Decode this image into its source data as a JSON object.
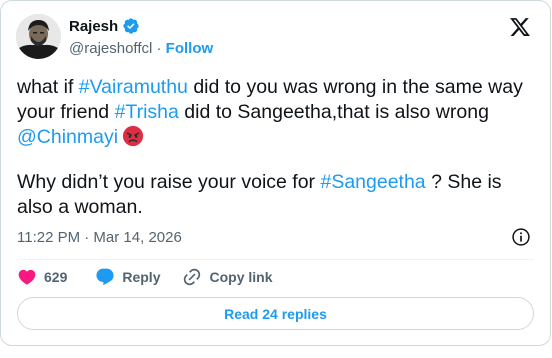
{
  "author": {
    "name": "Rajesh",
    "handle": "@rajeshoffcl",
    "separator": "·",
    "follow_label": "Follow"
  },
  "tweet": {
    "line1_parts": [
      {
        "text": "what if ",
        "link": false
      },
      {
        "text": "#Vairamuthu",
        "link": true
      },
      {
        "text": " did to you was wrong in the same way your friend ",
        "link": false
      },
      {
        "text": "#Trisha",
        "link": true
      },
      {
        "text": " did to Sangeetha,that is also wrong ",
        "link": false
      },
      {
        "text": "@Chinmayi",
        "link": true
      }
    ],
    "line2_parts": [
      {
        "text": "Why didn’t you raise your voice for ",
        "link": false
      },
      {
        "text": "#Sangeetha",
        "link": true
      },
      {
        "text": " ? She is also a woman.",
        "link": false
      }
    ],
    "emoji": "angry-face-emoji"
  },
  "timestamp": "11:22 PM · Mar 14, 2026",
  "actions": {
    "like_count": "629",
    "reply_label": "Reply",
    "copy_label": "Copy link"
  },
  "read_replies_label": "Read 24 replies",
  "colors": {
    "accent": "#1d9bf0",
    "like": "#f91880",
    "secondary_text": "#536471",
    "border": "#cfd9de"
  },
  "icons": [
    "verified-badge-icon",
    "x-logo-icon",
    "info-icon",
    "heart-icon",
    "reply-bubble-icon",
    "copy-link-icon"
  ]
}
